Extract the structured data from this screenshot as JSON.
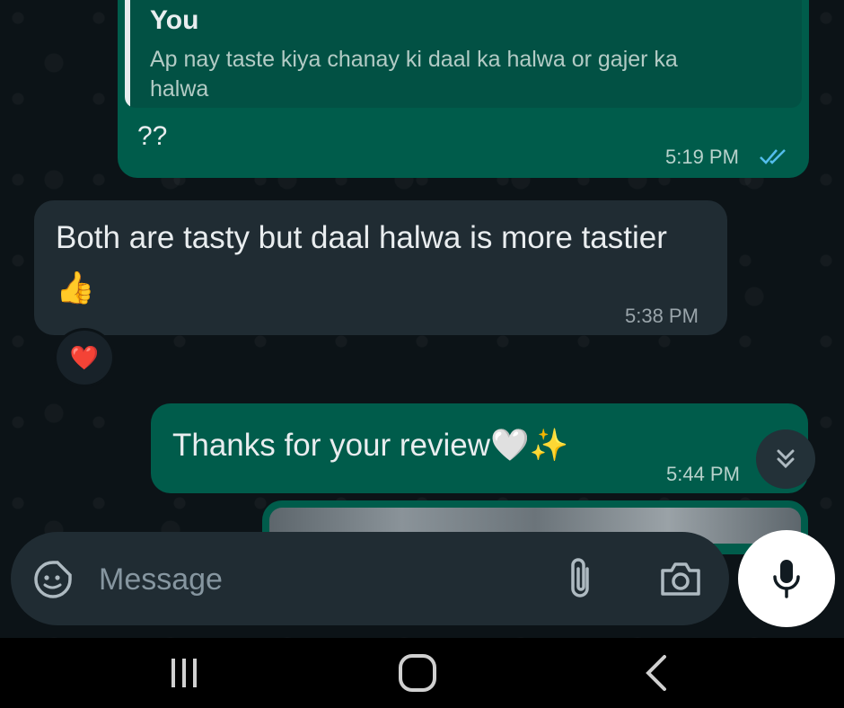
{
  "messages": [
    {
      "direction": "outgoing",
      "quote": {
        "author": "You",
        "text": "Ap nay taste kiya chanay ki daal ka halwa or gajer ka halwa"
      },
      "text": "??",
      "time": "5:19 PM",
      "status": "read"
    },
    {
      "direction": "incoming",
      "text": "Both are tasty but daal halwa is more tastier 👍",
      "time": "5:38 PM",
      "reaction": "❤️"
    },
    {
      "direction": "outgoing",
      "text": "Thanks for your review🤍✨",
      "time": "5:44 PM"
    }
  ],
  "composer": {
    "placeholder": "Message",
    "icons": [
      "sticker-icon",
      "paperclip-icon",
      "camera-icon",
      "microphone-icon"
    ]
  },
  "scroll_button_icon": "double-chevron-down-icon",
  "navbar": {
    "icons": [
      "recent-apps-icon",
      "home-icon",
      "back-icon"
    ]
  },
  "colors": {
    "outgoing_bubble": "#005c4b",
    "incoming_bubble": "#202c33",
    "read_ticks": "#53bdeb"
  }
}
